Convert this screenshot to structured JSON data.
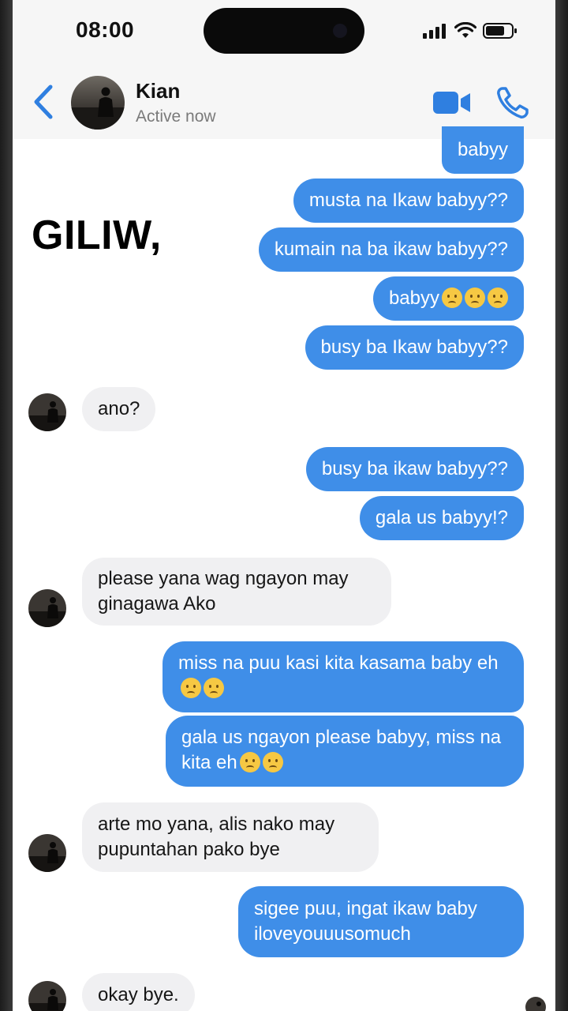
{
  "status_bar": {
    "time": "08:00"
  },
  "contact": {
    "name": "Kian",
    "status": "Active now"
  },
  "overlay_text": "GILIW,",
  "messages": [
    {
      "from": "me",
      "text": "babyy"
    },
    {
      "from": "me",
      "text": "musta na Ikaw babyy??"
    },
    {
      "from": "me",
      "text": "kumain na ba ikaw babyy??"
    },
    {
      "from": "me",
      "text": "babyy",
      "emojis": [
        "confused-emoji",
        "frowning-emoji",
        "confused-emoji"
      ]
    },
    {
      "from": "me",
      "text": "busy ba Ikaw babyy??"
    },
    {
      "from": "them",
      "text": "ano?"
    },
    {
      "from": "me",
      "text": "busy ba ikaw babyy??"
    },
    {
      "from": "me",
      "text": "gala us babyy!?"
    },
    {
      "from": "them",
      "text": "please yana wag ngayon may ginagawa Ako"
    },
    {
      "from": "me",
      "text": "miss na puu kasi kita kasama baby eh",
      "emojis": [
        "confused-emoji",
        "confused-emoji"
      ]
    },
    {
      "from": "me",
      "text": "gala us ngayon please babyy, miss na kita eh",
      "emojis": [
        "confused-emoji",
        "frowning-emoji"
      ]
    },
    {
      "from": "them",
      "text": "arte mo yana, alis nako may pupuntahan pako bye"
    },
    {
      "from": "me",
      "text": "sigee puu, ingat ikaw baby iloveyouuusomuch"
    },
    {
      "from": "them",
      "text": "okay bye."
    }
  ],
  "colors": {
    "outgoing_bubble": "#3f8ee8",
    "incoming_bubble": "#f0f0f2",
    "accent": "#2f7fe0",
    "header_bg": "#f6f6f6"
  },
  "icons": [
    "back-chevron-icon",
    "video-call-icon",
    "phone-call-icon",
    "signal-icon",
    "wifi-icon",
    "battery-icon"
  ]
}
